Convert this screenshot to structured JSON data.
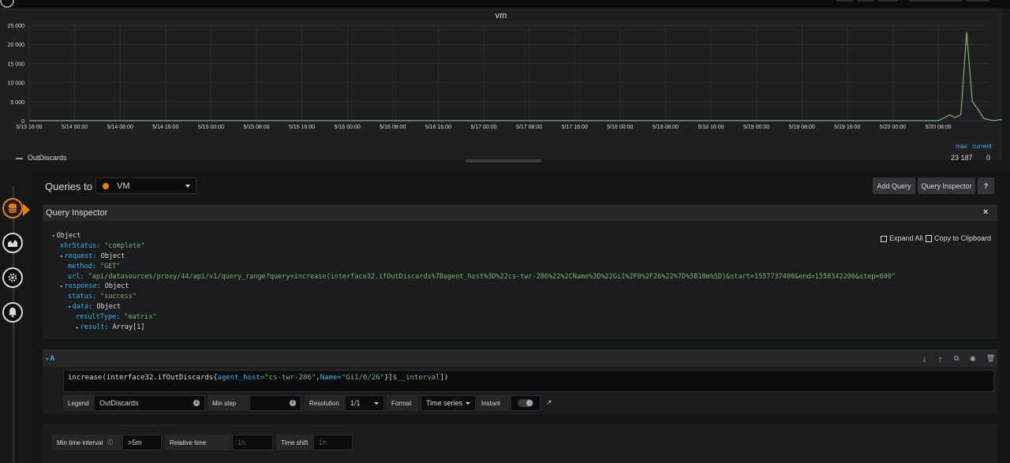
{
  "panel": {
    "title": "vm",
    "y_ticks": [
      "25 000",
      "20 000",
      "15 000",
      "10 000",
      "5 000",
      "0"
    ],
    "x_ticks": [
      "5/13 16:00",
      "5/14 00:00",
      "5/14 08:00",
      "5/14 16:00",
      "5/15 00:00",
      "5/15 08:00",
      "5/15 16:00",
      "5/16 00:00",
      "5/16 08:00",
      "5/16 16:00",
      "5/17 00:00",
      "5/17 08:00",
      "5/17 16:00",
      "5/18 00:00",
      "5/18 08:00",
      "5/18 16:00",
      "5/19 00:00",
      "5/19 08:00",
      "5/19 16:00",
      "5/20 00:00",
      "5/20 08:00"
    ],
    "legend": {
      "series_name": "OutDiscards",
      "series_color": "#7eb26d",
      "max_label": "max",
      "current_label": "current",
      "max_value": "23 187",
      "current_value": "0"
    }
  },
  "chart_data": {
    "type": "line",
    "title": "vm",
    "ylim": [
      0,
      25000
    ],
    "series": [
      {
        "name": "OutDiscards",
        "color": "#7eb26d",
        "points": [
          [
            "5/20 07:00",
            0
          ],
          [
            "5/20 08:00",
            0
          ],
          [
            "5/20 09:00",
            700
          ],
          [
            "5/20 10:00",
            1500
          ],
          [
            "5/20 11:00",
            800
          ],
          [
            "5/20 12:00",
            1600
          ],
          [
            "5/20 13:00",
            23187
          ],
          [
            "5/20 14:00",
            5000
          ],
          [
            "5/20 15:00",
            3000
          ],
          [
            "5/20 16:00",
            600
          ],
          [
            "5/20 17:00",
            200
          ],
          [
            "5/20 18:00",
            0
          ],
          [
            "5/20 19:00",
            300
          ],
          [
            "5/20 20:00",
            0
          ],
          [
            "5/20 21:00",
            0
          ]
        ]
      }
    ]
  },
  "editor": {
    "queries_to_label": "Queries to",
    "datasource": "VM",
    "add_query_label": "Add Query",
    "query_inspector_label": "Query Inspector",
    "help_label": "?"
  },
  "inspector": {
    "title": "Query Inspector",
    "close_label": "×",
    "expand_all_label": "Expand All",
    "copy_label": "Copy to Clipboard",
    "root": "Object",
    "xhr_key": "xhrStatus:",
    "xhr_val": "\"complete\"",
    "request_key": "request:",
    "request_type": "Object",
    "method_key": "method:",
    "method_val": "\"GET\"",
    "url_key": "url:",
    "url_val": "\"api/datasources/proxy/44/api/v1/query_range?query=increase(interface32.ifOutDiscards%7Bagent_host%3D%22cs-twr-286%22%2CName%3D%22Gi1%2F0%2F26%22%7D%5B10m%5D)&start=1557737400&end=1558342200&step=600\"",
    "response_key": "response:",
    "response_type": "Object",
    "status_key": "status:",
    "status_val": "\"success\"",
    "data_key": "data:",
    "data_type": "Object",
    "result_type_key": "resultType:",
    "result_type_val": "\"matrix\"",
    "result_key": "result:",
    "result_val": "Array[1]"
  },
  "query_a": {
    "ref": "A",
    "expr_prefix": "increase(interface32.ifOutDiscards{",
    "expr_label1": "agent_host=",
    "expr_val1": "\"cs-twr-286\"",
    "expr_comma": ",",
    "expr_label2": "Name=",
    "expr_val2": "\"Gi1/0/26\"",
    "expr_suffix": "}[",
    "expr_var": "$__interval",
    "expr_end": "])",
    "legend_label": "Legend",
    "legend_value": "OutDiscards",
    "min_step_label": "Min step",
    "min_step_value": "",
    "resolution_label": "Resolution",
    "resolution_value": "1/1",
    "format_label": "Format",
    "format_value": "Time series",
    "instant_label": "Instant"
  },
  "options": {
    "min_interval_label": "Min time interval",
    "min_interval_value": ">5m",
    "relative_time_label": "Relative time",
    "relative_time_placeholder": "1h",
    "time_shift_label": "Time shift",
    "time_shift_placeholder": "1h"
  }
}
